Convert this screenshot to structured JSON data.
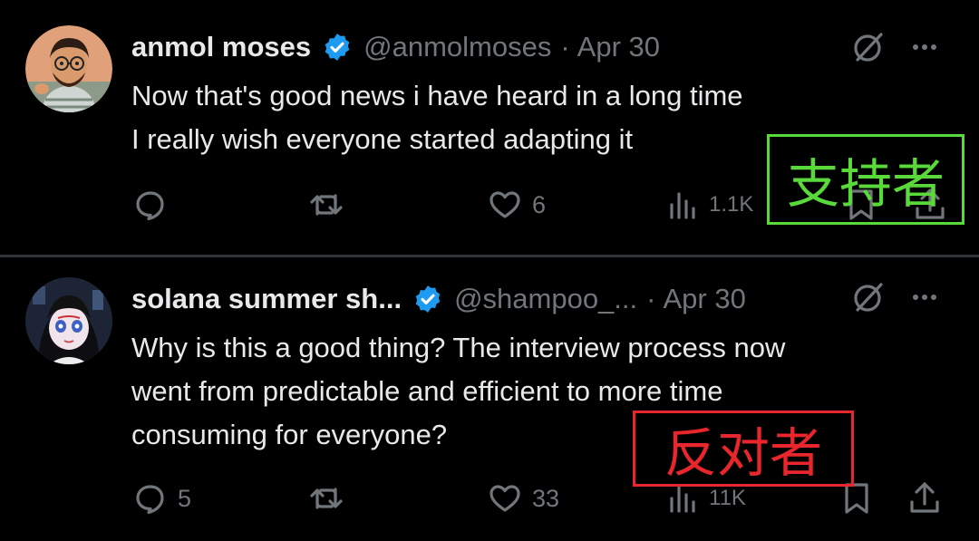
{
  "tweets": [
    {
      "author": {
        "name": "anmol moses",
        "handle": "@anmolmoses",
        "verified": true,
        "avatar": "cartoon-man-with-glasses"
      },
      "separator": "·",
      "date": "Apr 30",
      "lines": [
        "Now that's good news i have heard in a long time",
        "I really wish everyone started adapting it"
      ],
      "stats": {
        "replies": "",
        "reposts": "",
        "likes": "6",
        "views": "1.1K"
      },
      "annotation": "支持者"
    },
    {
      "author": {
        "name": "solana summer sh...",
        "handle": "@shampoo_...",
        "verified": true,
        "avatar": "anime-girl"
      },
      "separator": "·",
      "date": "Apr 30",
      "lines": [
        "Why is this a good thing? The interview process now",
        "went from predictable and efficient to more time",
        "consuming for everyone?"
      ],
      "stats": {
        "replies": "5",
        "reposts": "",
        "likes": "33",
        "views": "11K"
      },
      "annotation": "反对者"
    }
  ],
  "colors": {
    "background": "#000000",
    "text": "#e7e9ea",
    "muted": "#71767b",
    "verified": "#1d9bf0",
    "supporter_label": "#59d93a",
    "opponent_label": "#e8262b"
  },
  "icons": [
    "verified-badge-icon",
    "grok-icon",
    "more-icon",
    "reply-icon",
    "repost-icon",
    "like-icon",
    "views-icon",
    "bookmark-icon",
    "share-icon"
  ]
}
